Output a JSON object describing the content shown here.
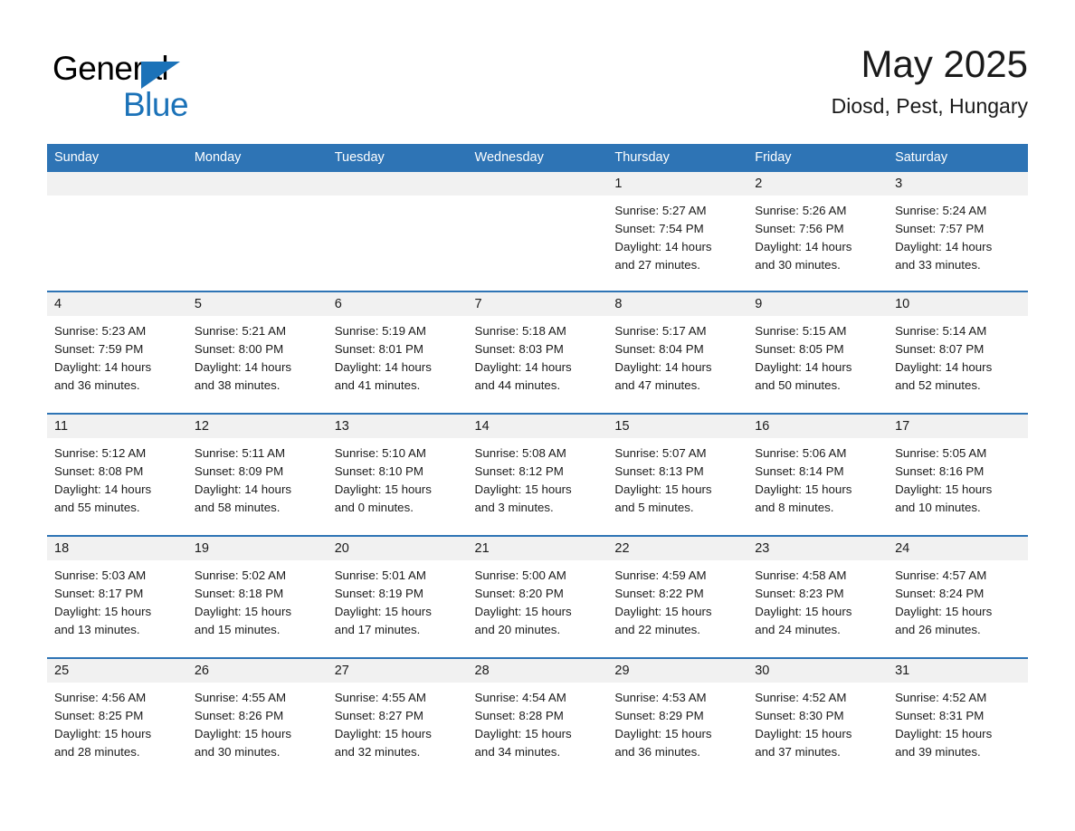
{
  "brand": {
    "name_part1": "General",
    "name_part2": "Blue",
    "accent_color": "#1b72b8"
  },
  "header": {
    "title": "May 2025",
    "subtitle": "Diosd, Pest, Hungary"
  },
  "theme": {
    "header_bar_color": "#2e74b5",
    "daynum_band_color": "#f1f1f1",
    "rule_color": "#2e74b5",
    "text_color": "#1a1a1a"
  },
  "columns": [
    "Sunday",
    "Monday",
    "Tuesday",
    "Wednesday",
    "Thursday",
    "Friday",
    "Saturday"
  ],
  "weeks": [
    [
      {
        "day": "",
        "sunrise": "",
        "sunset": "",
        "daylight_line1": "",
        "daylight_line2": ""
      },
      {
        "day": "",
        "sunrise": "",
        "sunset": "",
        "daylight_line1": "",
        "daylight_line2": ""
      },
      {
        "day": "",
        "sunrise": "",
        "sunset": "",
        "daylight_line1": "",
        "daylight_line2": ""
      },
      {
        "day": "",
        "sunrise": "",
        "sunset": "",
        "daylight_line1": "",
        "daylight_line2": ""
      },
      {
        "day": "1",
        "sunrise": "Sunrise: 5:27 AM",
        "sunset": "Sunset: 7:54 PM",
        "daylight_line1": "Daylight: 14 hours",
        "daylight_line2": "and 27 minutes."
      },
      {
        "day": "2",
        "sunrise": "Sunrise: 5:26 AM",
        "sunset": "Sunset: 7:56 PM",
        "daylight_line1": "Daylight: 14 hours",
        "daylight_line2": "and 30 minutes."
      },
      {
        "day": "3",
        "sunrise": "Sunrise: 5:24 AM",
        "sunset": "Sunset: 7:57 PM",
        "daylight_line1": "Daylight: 14 hours",
        "daylight_line2": "and 33 minutes."
      }
    ],
    [
      {
        "day": "4",
        "sunrise": "Sunrise: 5:23 AM",
        "sunset": "Sunset: 7:59 PM",
        "daylight_line1": "Daylight: 14 hours",
        "daylight_line2": "and 36 minutes."
      },
      {
        "day": "5",
        "sunrise": "Sunrise: 5:21 AM",
        "sunset": "Sunset: 8:00 PM",
        "daylight_line1": "Daylight: 14 hours",
        "daylight_line2": "and 38 minutes."
      },
      {
        "day": "6",
        "sunrise": "Sunrise: 5:19 AM",
        "sunset": "Sunset: 8:01 PM",
        "daylight_line1": "Daylight: 14 hours",
        "daylight_line2": "and 41 minutes."
      },
      {
        "day": "7",
        "sunrise": "Sunrise: 5:18 AM",
        "sunset": "Sunset: 8:03 PM",
        "daylight_line1": "Daylight: 14 hours",
        "daylight_line2": "and 44 minutes."
      },
      {
        "day": "8",
        "sunrise": "Sunrise: 5:17 AM",
        "sunset": "Sunset: 8:04 PM",
        "daylight_line1": "Daylight: 14 hours",
        "daylight_line2": "and 47 minutes."
      },
      {
        "day": "9",
        "sunrise": "Sunrise: 5:15 AM",
        "sunset": "Sunset: 8:05 PM",
        "daylight_line1": "Daylight: 14 hours",
        "daylight_line2": "and 50 minutes."
      },
      {
        "day": "10",
        "sunrise": "Sunrise: 5:14 AM",
        "sunset": "Sunset: 8:07 PM",
        "daylight_line1": "Daylight: 14 hours",
        "daylight_line2": "and 52 minutes."
      }
    ],
    [
      {
        "day": "11",
        "sunrise": "Sunrise: 5:12 AM",
        "sunset": "Sunset: 8:08 PM",
        "daylight_line1": "Daylight: 14 hours",
        "daylight_line2": "and 55 minutes."
      },
      {
        "day": "12",
        "sunrise": "Sunrise: 5:11 AM",
        "sunset": "Sunset: 8:09 PM",
        "daylight_line1": "Daylight: 14 hours",
        "daylight_line2": "and 58 minutes."
      },
      {
        "day": "13",
        "sunrise": "Sunrise: 5:10 AM",
        "sunset": "Sunset: 8:10 PM",
        "daylight_line1": "Daylight: 15 hours",
        "daylight_line2": "and 0 minutes."
      },
      {
        "day": "14",
        "sunrise": "Sunrise: 5:08 AM",
        "sunset": "Sunset: 8:12 PM",
        "daylight_line1": "Daylight: 15 hours",
        "daylight_line2": "and 3 minutes."
      },
      {
        "day": "15",
        "sunrise": "Sunrise: 5:07 AM",
        "sunset": "Sunset: 8:13 PM",
        "daylight_line1": "Daylight: 15 hours",
        "daylight_line2": "and 5 minutes."
      },
      {
        "day": "16",
        "sunrise": "Sunrise: 5:06 AM",
        "sunset": "Sunset: 8:14 PM",
        "daylight_line1": "Daylight: 15 hours",
        "daylight_line2": "and 8 minutes."
      },
      {
        "day": "17",
        "sunrise": "Sunrise: 5:05 AM",
        "sunset": "Sunset: 8:16 PM",
        "daylight_line1": "Daylight: 15 hours",
        "daylight_line2": "and 10 minutes."
      }
    ],
    [
      {
        "day": "18",
        "sunrise": "Sunrise: 5:03 AM",
        "sunset": "Sunset: 8:17 PM",
        "daylight_line1": "Daylight: 15 hours",
        "daylight_line2": "and 13 minutes."
      },
      {
        "day": "19",
        "sunrise": "Sunrise: 5:02 AM",
        "sunset": "Sunset: 8:18 PM",
        "daylight_line1": "Daylight: 15 hours",
        "daylight_line2": "and 15 minutes."
      },
      {
        "day": "20",
        "sunrise": "Sunrise: 5:01 AM",
        "sunset": "Sunset: 8:19 PM",
        "daylight_line1": "Daylight: 15 hours",
        "daylight_line2": "and 17 minutes."
      },
      {
        "day": "21",
        "sunrise": "Sunrise: 5:00 AM",
        "sunset": "Sunset: 8:20 PM",
        "daylight_line1": "Daylight: 15 hours",
        "daylight_line2": "and 20 minutes."
      },
      {
        "day": "22",
        "sunrise": "Sunrise: 4:59 AM",
        "sunset": "Sunset: 8:22 PM",
        "daylight_line1": "Daylight: 15 hours",
        "daylight_line2": "and 22 minutes."
      },
      {
        "day": "23",
        "sunrise": "Sunrise: 4:58 AM",
        "sunset": "Sunset: 8:23 PM",
        "daylight_line1": "Daylight: 15 hours",
        "daylight_line2": "and 24 minutes."
      },
      {
        "day": "24",
        "sunrise": "Sunrise: 4:57 AM",
        "sunset": "Sunset: 8:24 PM",
        "daylight_line1": "Daylight: 15 hours",
        "daylight_line2": "and 26 minutes."
      }
    ],
    [
      {
        "day": "25",
        "sunrise": "Sunrise: 4:56 AM",
        "sunset": "Sunset: 8:25 PM",
        "daylight_line1": "Daylight: 15 hours",
        "daylight_line2": "and 28 minutes."
      },
      {
        "day": "26",
        "sunrise": "Sunrise: 4:55 AM",
        "sunset": "Sunset: 8:26 PM",
        "daylight_line1": "Daylight: 15 hours",
        "daylight_line2": "and 30 minutes."
      },
      {
        "day": "27",
        "sunrise": "Sunrise: 4:55 AM",
        "sunset": "Sunset: 8:27 PM",
        "daylight_line1": "Daylight: 15 hours",
        "daylight_line2": "and 32 minutes."
      },
      {
        "day": "28",
        "sunrise": "Sunrise: 4:54 AM",
        "sunset": "Sunset: 8:28 PM",
        "daylight_line1": "Daylight: 15 hours",
        "daylight_line2": "and 34 minutes."
      },
      {
        "day": "29",
        "sunrise": "Sunrise: 4:53 AM",
        "sunset": "Sunset: 8:29 PM",
        "daylight_line1": "Daylight: 15 hours",
        "daylight_line2": "and 36 minutes."
      },
      {
        "day": "30",
        "sunrise": "Sunrise: 4:52 AM",
        "sunset": "Sunset: 8:30 PM",
        "daylight_line1": "Daylight: 15 hours",
        "daylight_line2": "and 37 minutes."
      },
      {
        "day": "31",
        "sunrise": "Sunrise: 4:52 AM",
        "sunset": "Sunset: 8:31 PM",
        "daylight_line1": "Daylight: 15 hours",
        "daylight_line2": "and 39 minutes."
      }
    ]
  ]
}
